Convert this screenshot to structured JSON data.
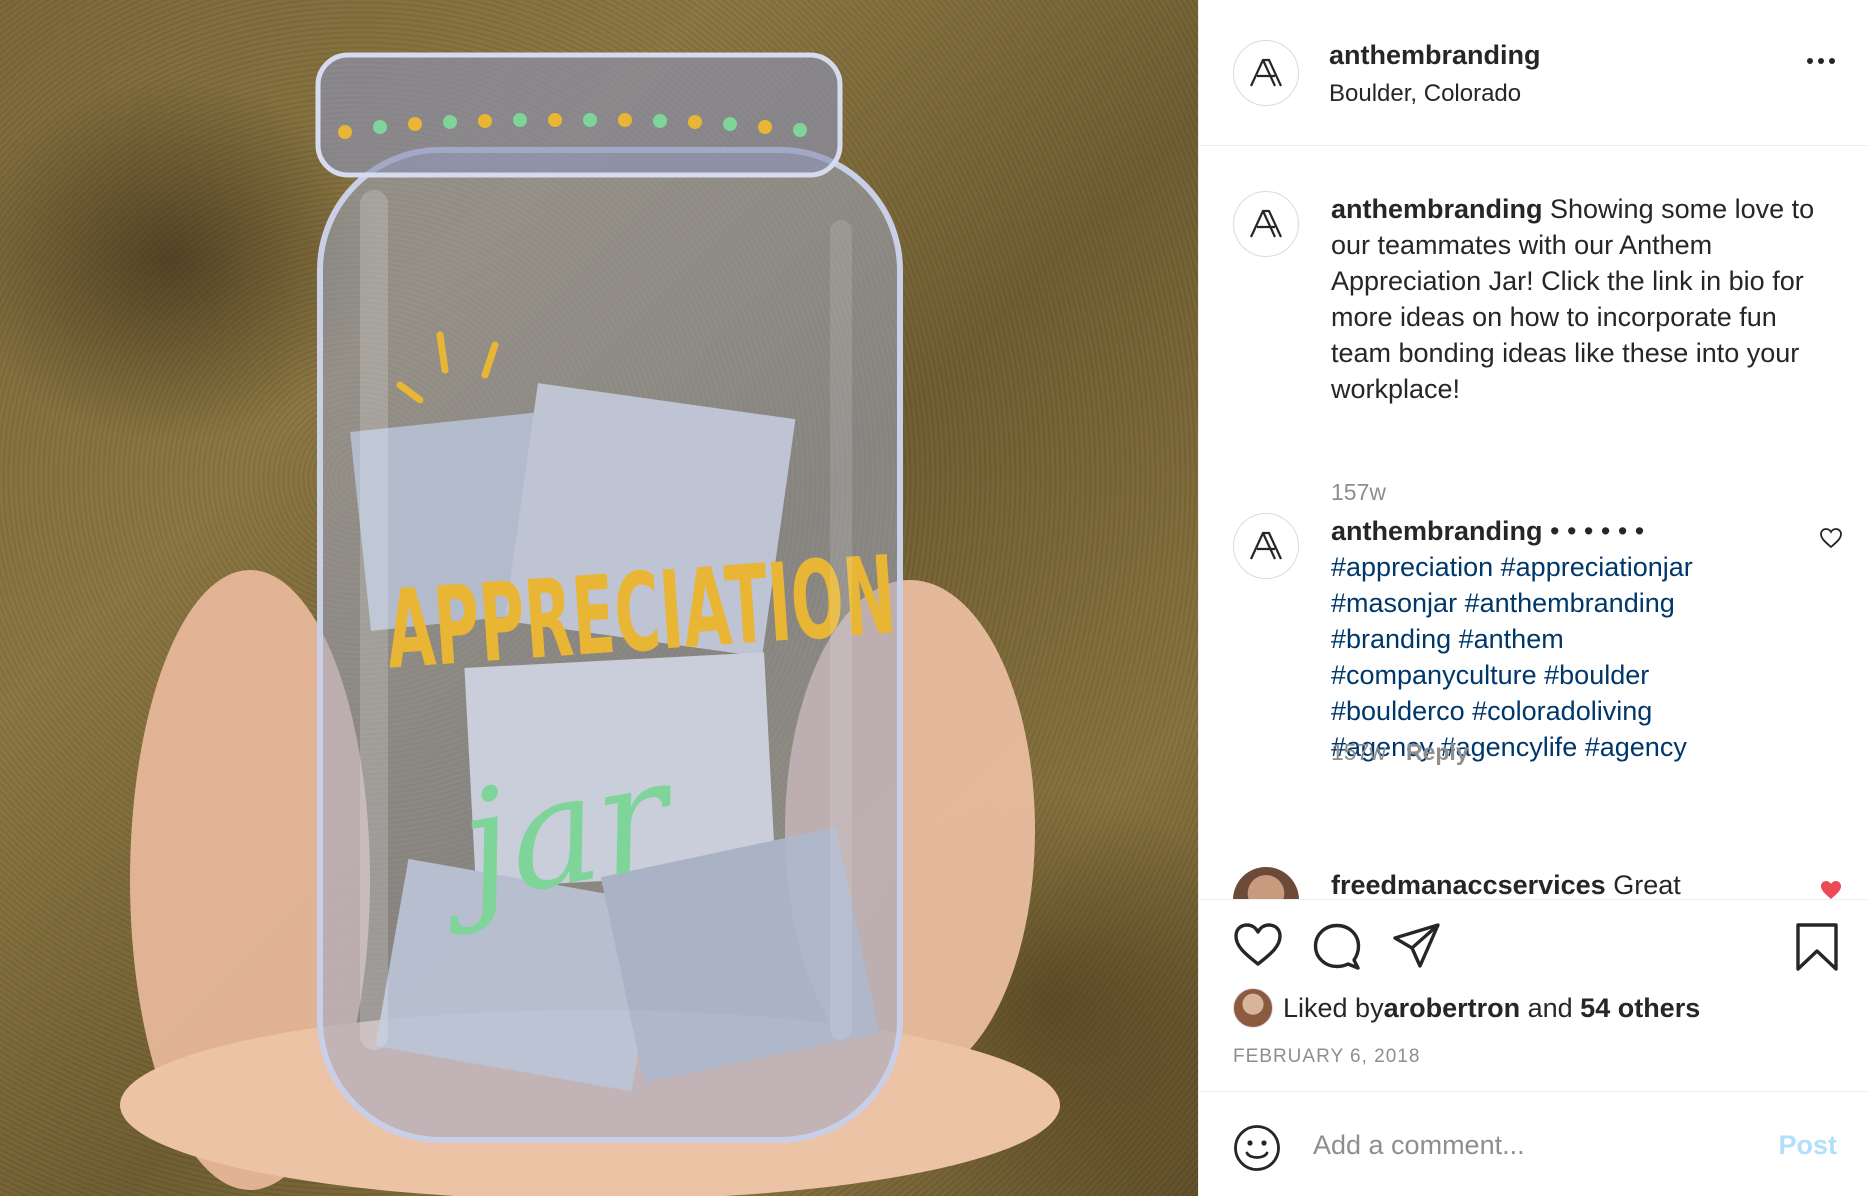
{
  "post": {
    "username": "anthembranding",
    "location": "Boulder, Colorado",
    "avatar_monogram": "A",
    "caption_username": "anthembranding",
    "caption_text": " Showing some love to our teammates with our Anthem Appreciation Jar! Click the link in bio for more ideas on how to incorporate fun team bonding ideas like these into your workplace!",
    "caption_time": "157w"
  },
  "hashtag_comment": {
    "username": "anthembranding",
    "dots": " • • • • • •",
    "hashtags": [
      "#appreciation",
      "#appreciationjar",
      "#masonjar",
      "#anthembranding",
      "#branding",
      "#anthem",
      "#companyculture",
      "#boulder",
      "#boulderco",
      "#coloradoliving",
      "#agency",
      "#agencylife",
      "#agency"
    ],
    "time": "157w",
    "reply_label": "Reply"
  },
  "partial_comment": {
    "username": "freedmanaccservices",
    "text": " Great"
  },
  "likes": {
    "prefix": "Liked by ",
    "liker": "arobertron",
    "conjunction": " and ",
    "others": "54 others"
  },
  "date": "FEBRUARY 6, 2018",
  "add_comment": {
    "placeholder": "Add a comment...",
    "post_label": "Post"
  },
  "image": {
    "jar_text_main": "APPRECIATION",
    "jar_text_script": "jar",
    "colors": {
      "jar_lettering": "#e8b634",
      "jar_script": "#7fd49a",
      "hashtag": "#00376b",
      "post_disabled": "#b2dffc"
    }
  },
  "icons": [
    "more-icon",
    "heart-icon",
    "comment-icon",
    "share-icon",
    "bookmark-icon",
    "emoji-icon",
    "small-heart-icon",
    "anthem-logo-icon"
  ]
}
